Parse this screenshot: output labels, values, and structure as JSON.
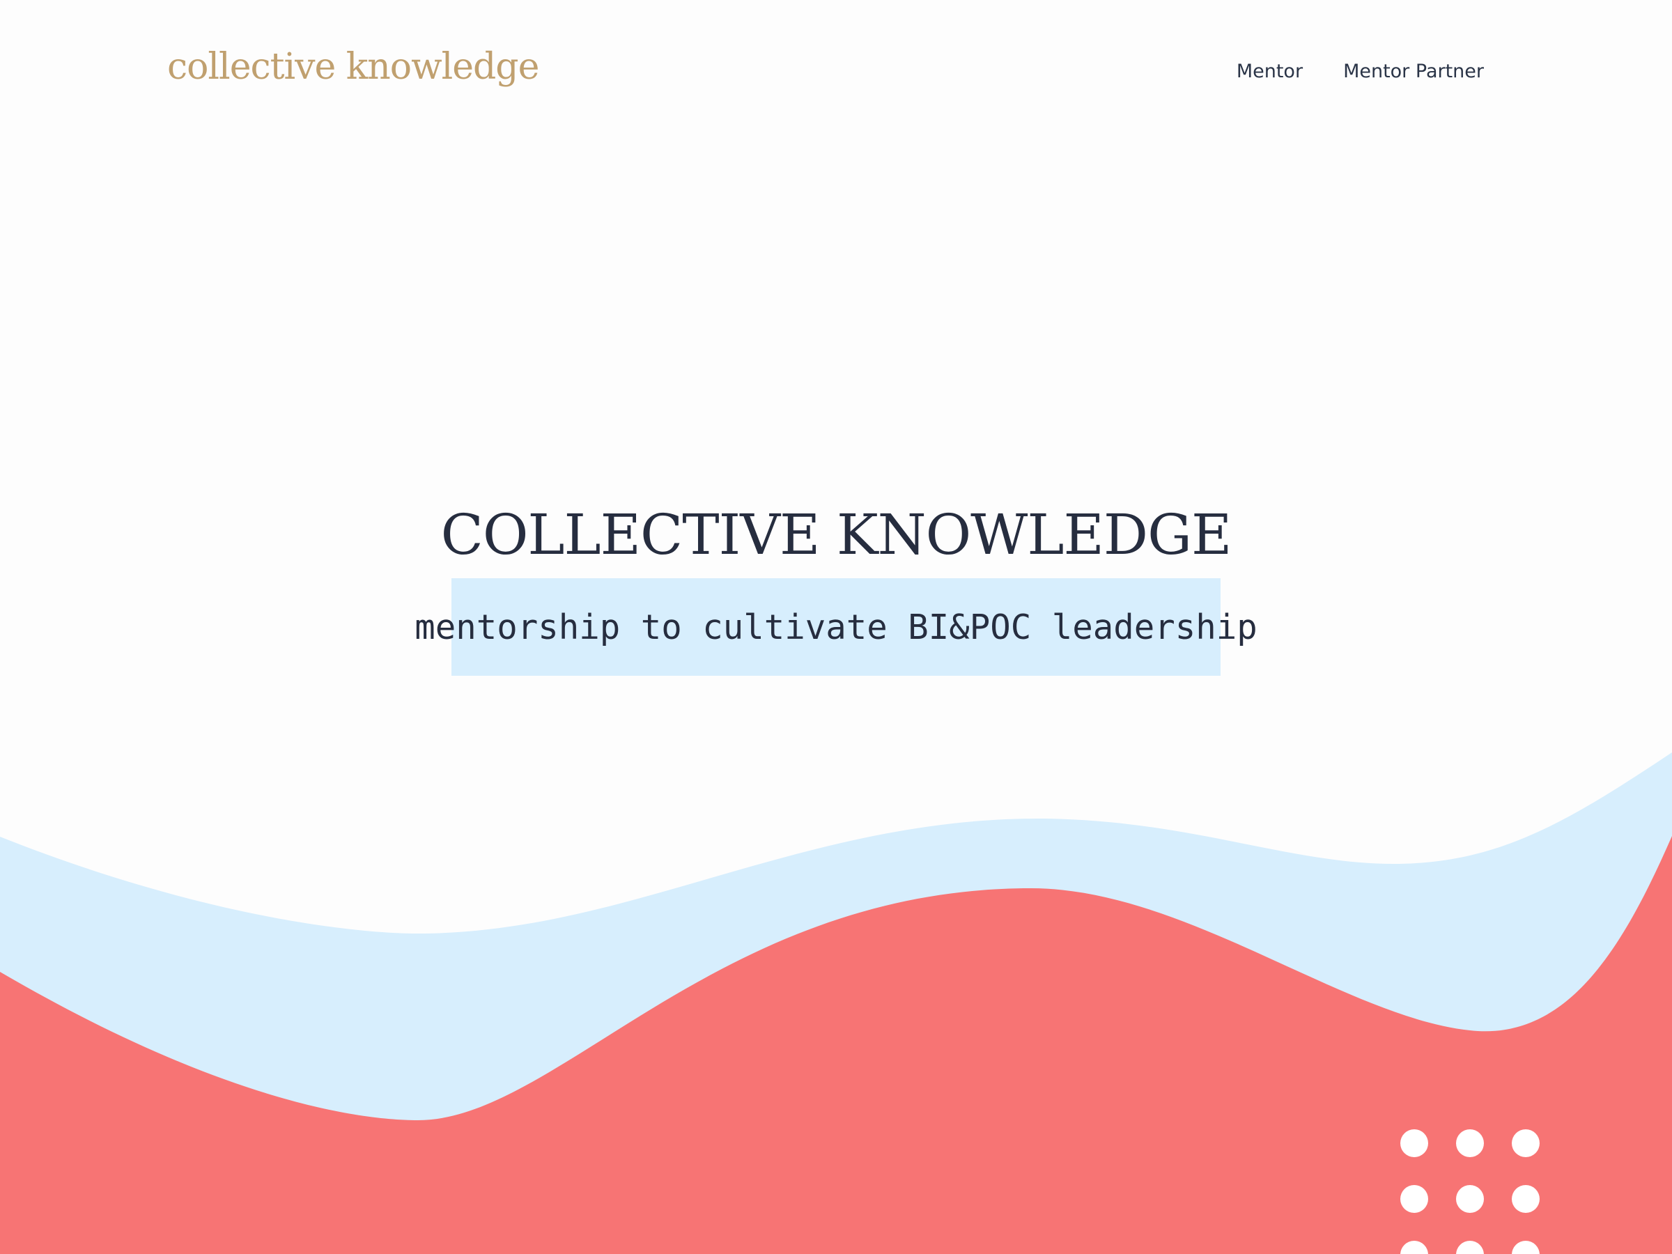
{
  "header": {
    "logo_text": "collective knowledge",
    "nav": [
      {
        "label": "Mentor"
      },
      {
        "label": "Mentor Partner"
      }
    ]
  },
  "hero": {
    "title": "COLLECTIVE KNOWLEDGE",
    "tagline": "mentorship to cultivate BI&POC leadership"
  },
  "colors": {
    "background": "#fdfdfd",
    "logo": "#c0a06f",
    "text": "#262d3f",
    "light_blue": "#d7eefd",
    "coral": "#f77474",
    "dots": "#ffffff"
  },
  "decorations": {
    "wave_layers": [
      "light-blue-wave",
      "coral-wave"
    ],
    "dot_grid": {
      "columns": 3,
      "rows_visible": 3
    }
  }
}
